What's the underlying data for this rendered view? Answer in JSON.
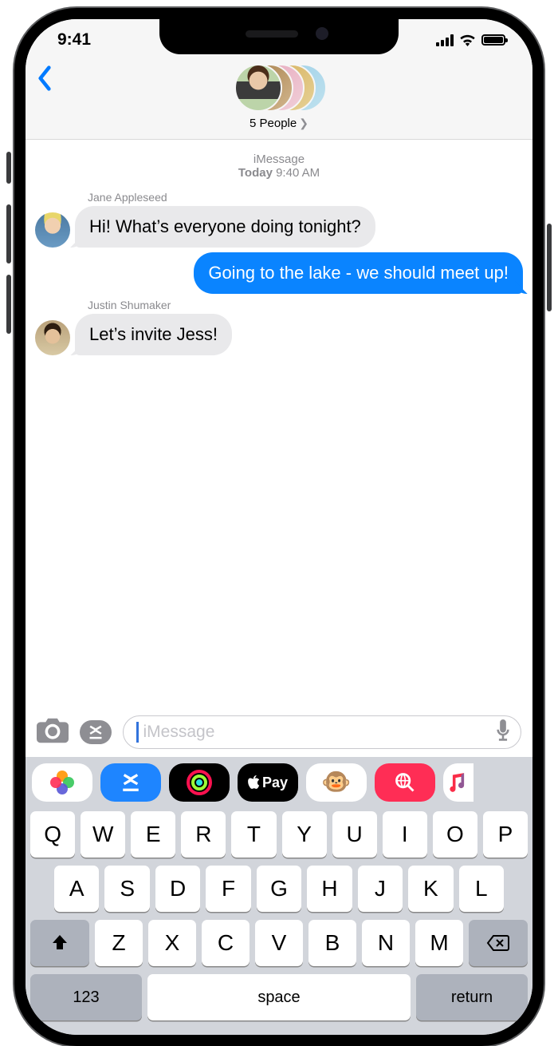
{
  "status": {
    "time": "9:41"
  },
  "header": {
    "group_label": "5 People"
  },
  "timestamp": {
    "type": "iMessage",
    "day": "Today",
    "time": "9:40 AM"
  },
  "messages": {
    "m0": {
      "sender": "Jane Appleseed",
      "text": "Hi! What’s everyone doing tonight?"
    },
    "m1": {
      "text": "Going to the lake - we should meet up!"
    },
    "m2": {
      "sender": "Justin Shumaker",
      "text": "Let’s invite Jess!"
    }
  },
  "compose": {
    "placeholder": "iMessage"
  },
  "apps": {
    "pay_label": "Pay"
  },
  "keyboard": {
    "row1": [
      "Q",
      "W",
      "E",
      "R",
      "T",
      "Y",
      "U",
      "I",
      "O",
      "P"
    ],
    "row2": [
      "A",
      "S",
      "D",
      "F",
      "G",
      "H",
      "J",
      "K",
      "L"
    ],
    "row3": [
      "Z",
      "X",
      "C",
      "V",
      "B",
      "N",
      "M"
    ],
    "numkey": "123",
    "space": "space",
    "ret": "return"
  }
}
